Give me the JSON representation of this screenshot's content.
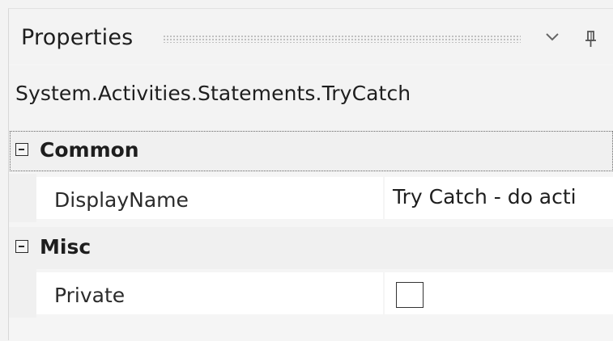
{
  "panel": {
    "title": "Properties",
    "chevron_icon": "chevron-down-icon",
    "pin_icon": "pin-icon"
  },
  "selected_type": "System.Activities.Statements.TryCatch",
  "categories": [
    {
      "name": "Common",
      "expanded": true,
      "properties": [
        {
          "name": "DisplayName",
          "value": "Try Catch - do acti"
        }
      ]
    },
    {
      "name": "Misc",
      "expanded": true,
      "properties": [
        {
          "name": "Private",
          "checked": false
        }
      ]
    }
  ]
}
